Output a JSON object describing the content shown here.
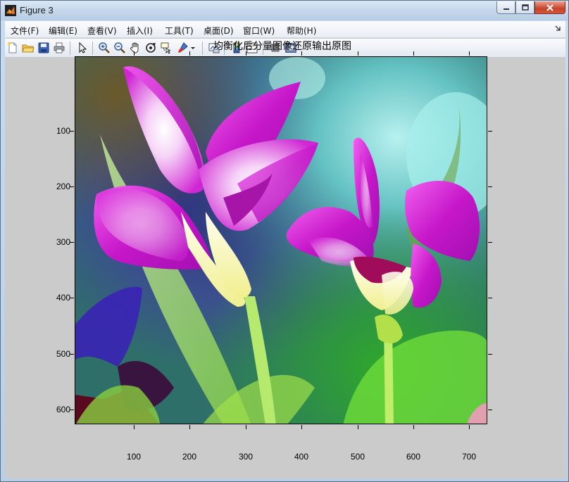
{
  "window": {
    "title": "Figure 3"
  },
  "menubar": {
    "items": [
      "文件(F)",
      "编辑(E)",
      "查看(V)",
      "插入(I)",
      "工具(T)",
      "桌面(D)",
      "窗口(W)",
      "帮助(H)"
    ]
  },
  "toolbar": {
    "buttons": [
      "new-figure",
      "open-file",
      "save",
      "print",
      "select-arrow",
      "zoom-in",
      "zoom-out",
      "pan",
      "rotate-3d",
      "data-cursor",
      "brush",
      "link-plot",
      "colorbar",
      "legend",
      "hide-plot-tools",
      "show-plot-tools"
    ]
  },
  "figure": {
    "title": "均衡化后分量图像还原输出原图",
    "x_ticks": [
      "100",
      "200",
      "300",
      "400",
      "500",
      "600",
      "700"
    ],
    "y_ticks": [
      "100",
      "200",
      "300",
      "400",
      "500",
      "600"
    ],
    "image_description_subject": "two magenta and white iris flowers on a teal, blue and green background"
  },
  "colors": {
    "canvas_bg": "#cbcbcb",
    "petal_magenta": "#d21fd6",
    "petal_highlight": "#fdf9c6",
    "background_teal": "#3f9a98",
    "stem_green": "#a8dc52"
  }
}
